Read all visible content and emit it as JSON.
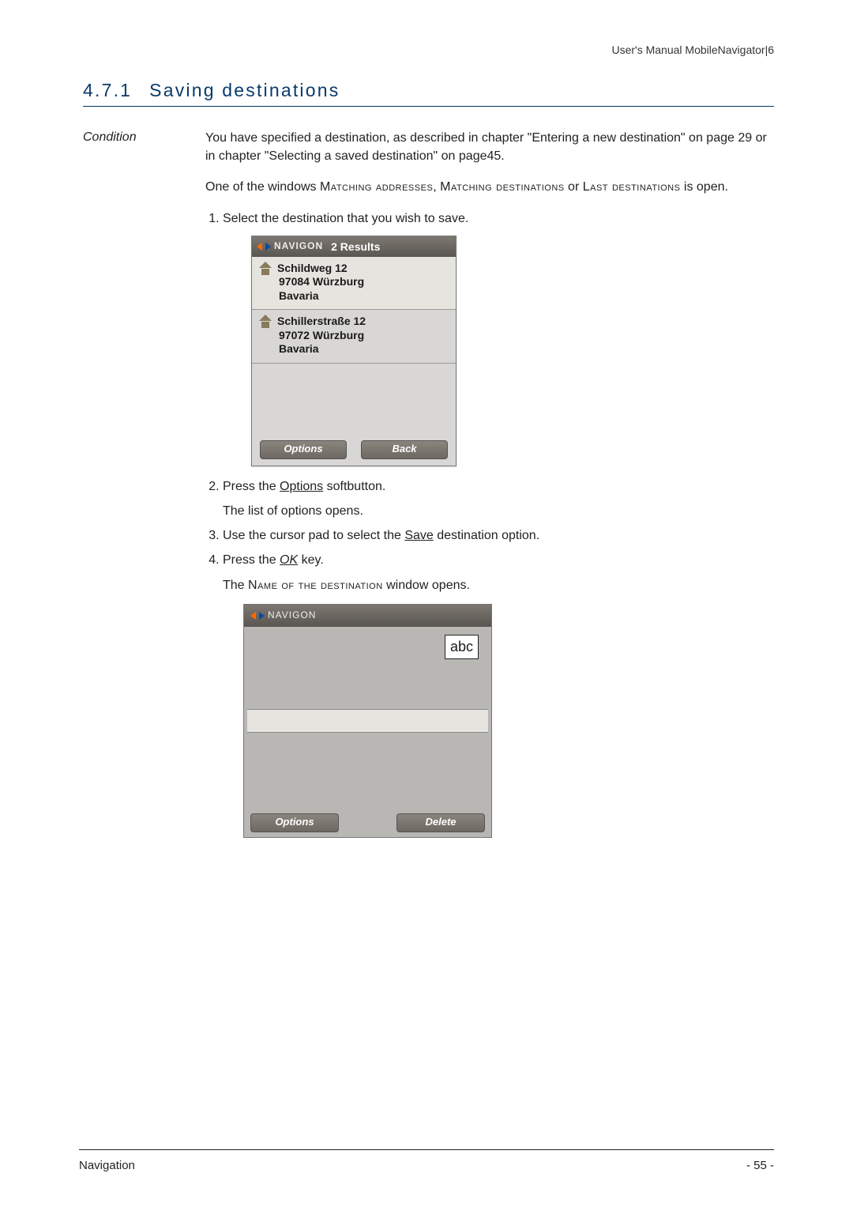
{
  "header": {
    "right": "User's Manual MobileNavigator|6"
  },
  "section": {
    "number": "4.7.1",
    "title": "Saving destinations"
  },
  "sideLabel": "Condition",
  "intro1": "You have specified a destination, as described in chapter \"Entering a new destination\" on page 29 or in chapter \"Selecting a saved destination\" on page45.",
  "intro2_a": "One of the windows ",
  "intro2_b": "Matching addresses",
  "intro2_c": ", ",
  "intro2_d": "Matching destinations",
  "intro2_e": " or ",
  "intro2_f": "Last destinations",
  "intro2_g": " is open.",
  "steps": {
    "s1": "Select the destination that you wish to save.",
    "s2_a": "Press the ",
    "s2_b": "Options",
    "s2_c": " softbutton.",
    "s2_follow": "The list of options opens.",
    "s3_a": "Use the cursor pad to select the ",
    "s3_b": "Save",
    "s3_c": " destination option.",
    "s4_a": "Press the ",
    "s4_b": "OK",
    "s4_c": " key.",
    "s4_follow_a": "The ",
    "s4_follow_b": "Name of the destination",
    "s4_follow_c": " window opens."
  },
  "device1": {
    "brand": "NAVIGON",
    "titleCount": "2 Results",
    "results": [
      {
        "line1": "Schildweg 12",
        "line2": "97084 Würzburg",
        "line3": "Bavaria"
      },
      {
        "line1": "Schillerstraße 12",
        "line2": "97072 Würzburg",
        "line3": "Bavaria"
      }
    ],
    "btnLeft": "Options",
    "btnRight": "Back"
  },
  "device2": {
    "brand": "NAVIGON",
    "mode": "abc",
    "btnLeft": "Options",
    "btnRight": "Delete"
  },
  "footer": {
    "left": "Navigation",
    "right": "- 55 -"
  }
}
